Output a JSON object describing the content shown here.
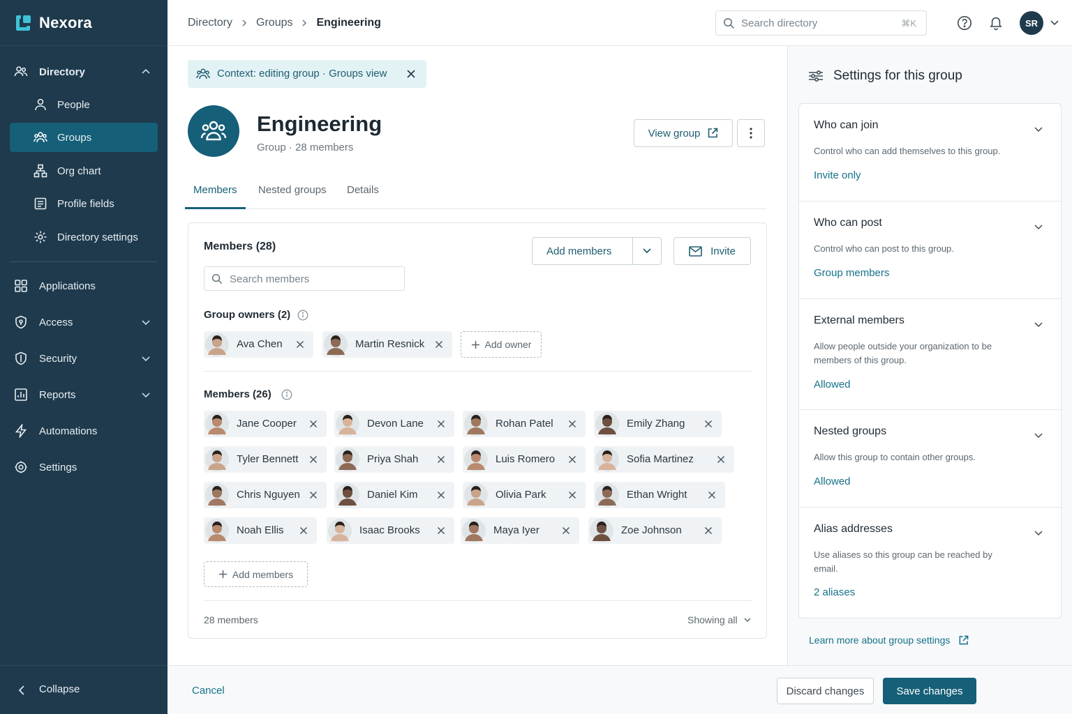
{
  "app": {
    "name": "Nexora"
  },
  "sidebar": {
    "items": [
      {
        "label": "Directory"
      },
      {
        "label": "People"
      },
      {
        "label": "Groups"
      },
      {
        "label": "Org chart"
      },
      {
        "label": "Profile fields"
      },
      {
        "label": "Directory settings"
      },
      {
        "label": "Applications"
      },
      {
        "label": "Access"
      },
      {
        "label": "Security"
      },
      {
        "label": "Reports"
      },
      {
        "label": "Automations"
      },
      {
        "label": "Settings"
      }
    ],
    "collapse_label": "Collapse"
  },
  "topbar": {
    "breadcrumb": [
      "Directory",
      "Groups",
      "Engineering"
    ],
    "search_placeholder": "Search directory",
    "search_shortcut": "⌘K",
    "user_initials": "SR"
  },
  "context_banner": "Context: editing group · Groups view",
  "group": {
    "name": "Engineering",
    "subtitle": "Group · 28 members",
    "view_button": "View group"
  },
  "tabs": [
    "Members",
    "Nested groups",
    "Details"
  ],
  "members_card": {
    "title": "Members (28)",
    "add_members_button": "Add members",
    "invite_button": "Invite",
    "search_placeholder": "Search members",
    "owners_label": "Group owners (2)",
    "owners": [
      "Ava Chen",
      "Martin Resnick"
    ],
    "add_owner": "Add owner",
    "members_label": "Members (26)",
    "members": [
      "Jane Cooper",
      "Devon Lane",
      "Rohan Patel",
      "Emily Zhang",
      "Tyler Bennett",
      "Priya Shah",
      "Luis Romero",
      "Sofia Martinez",
      "Chris Nguyen",
      "Daniel Kim",
      "Olivia Park",
      "Ethan Wright",
      "Noah Ellis",
      "Isaac Brooks",
      "Maya Iyer",
      "Zoe Johnson"
    ],
    "add_members_dashed": "Add members",
    "footer_count": "28 members",
    "footer_showing": "Showing all"
  },
  "settings_panel": {
    "title": "Settings for this group",
    "items": [
      {
        "title": "Who can join",
        "description": "Control who can add themselves to this group.",
        "value": "Invite only"
      },
      {
        "title": "Who can post",
        "description": "Control who can post to this group.",
        "value": "Group members"
      },
      {
        "title": "External members",
        "description": "Allow people outside your organization to be members of this group.",
        "value": "Allowed"
      },
      {
        "title": "Nested groups",
        "description": "Allow this group to contain other groups.",
        "value": "Allowed"
      },
      {
        "title": "Alias addresses",
        "description": "Use aliases so this group can be reached by email.",
        "value": "2 aliases"
      }
    ],
    "learn_more": "Learn more about group settings"
  },
  "footer": {
    "cancel": "Cancel",
    "discard": "Discard changes",
    "save": "Save changes"
  },
  "colors": {
    "sidebar_bg": "#1f3a4d",
    "accent": "#155f78",
    "link": "#16718a",
    "context_bg": "#e3f2f5"
  }
}
